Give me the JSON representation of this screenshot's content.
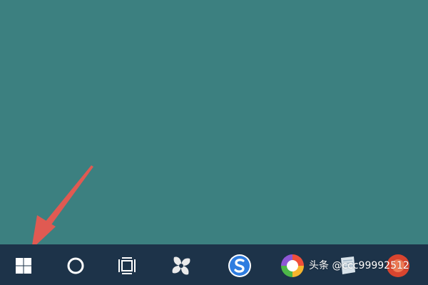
{
  "colors": {
    "desktop": "#3c8080",
    "taskbar": "#1d3349",
    "arrow": "#e05a52"
  },
  "taskbar": {
    "items": [
      {
        "icon": "windows-start-icon"
      },
      {
        "icon": "cortana-search-icon"
      },
      {
        "icon": "task-view-icon"
      },
      {
        "icon": "pinwheel-app-icon"
      },
      {
        "icon": "sogou-browser-icon"
      },
      {
        "icon": "colorful-circle-app-icon"
      },
      {
        "icon": "notepad-app-icon"
      },
      {
        "icon": "red-app-icon"
      }
    ]
  },
  "watermark": {
    "text": "头条 @ccc99992512"
  }
}
